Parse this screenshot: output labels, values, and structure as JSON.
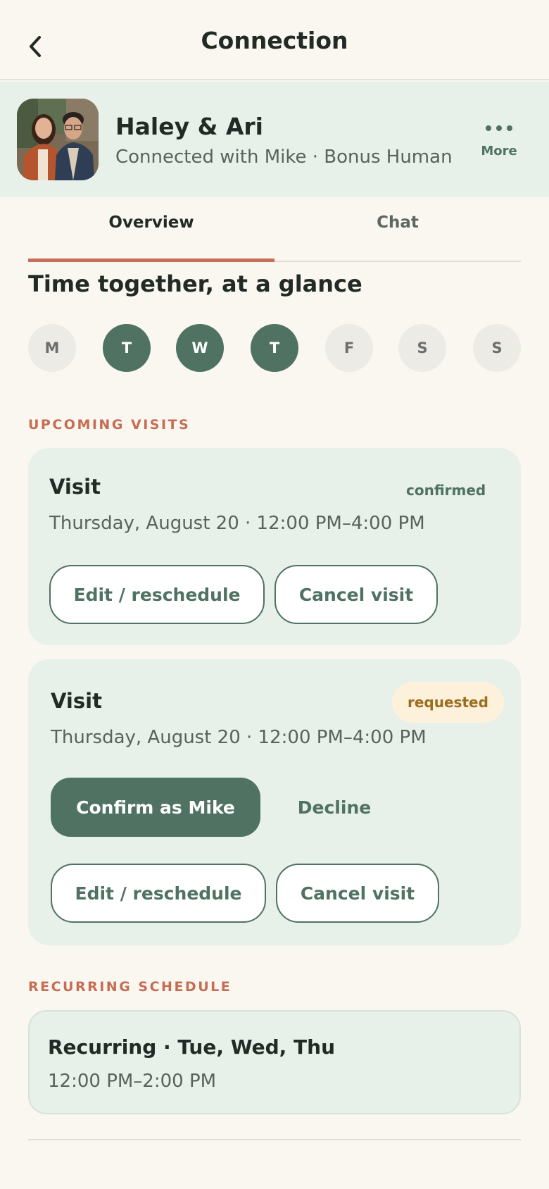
{
  "header": {
    "title": "Connection",
    "back_icon": "chevron-left-icon"
  },
  "profile": {
    "name": "Haley & Ari",
    "subtitle": "Connected with Mike · Bonus Human",
    "more_label": "More",
    "more_icon": "more-horizontal-icon"
  },
  "tabs": [
    {
      "label": "Overview",
      "active": true
    },
    {
      "label": "Chat",
      "active": false
    }
  ],
  "glance": {
    "title": "Time together, at a glance",
    "days": [
      {
        "letter": "M",
        "active": false
      },
      {
        "letter": "T",
        "active": true
      },
      {
        "letter": "W",
        "active": true
      },
      {
        "letter": "T",
        "active": true
      },
      {
        "letter": "F",
        "active": false
      },
      {
        "letter": "S",
        "active": false
      },
      {
        "letter": "S",
        "active": false
      }
    ]
  },
  "upcoming": {
    "label": "UPCOMING VISITS",
    "visits": [
      {
        "title": "Visit",
        "status": "confirmed",
        "time": "Thursday, August 20 · 12:00 PM–4:00 PM",
        "edit_label": "Edit / reschedule",
        "cancel_label": "Cancel visit"
      },
      {
        "title": "Visit",
        "status": "requested",
        "time": "Thursday, August 20 · 12:00 PM–4:00 PM",
        "confirm_label": "Confirm as Mike",
        "decline_label": "Decline",
        "edit_label": "Edit / reschedule",
        "cancel_label": "Cancel visit"
      }
    ]
  },
  "recurring": {
    "label": "RECURRING SCHEDULE",
    "title": "Recurring · Tue, Wed, Thu",
    "time": "12:00 PM–2:00 PM"
  },
  "colors": {
    "accent": "#c6705a",
    "primary": "#4f7262",
    "card_bg": "#e7f0e9",
    "page_bg": "#faf7f1",
    "requested_bg": "#fdf1db",
    "requested_text": "#9b6d1f"
  }
}
